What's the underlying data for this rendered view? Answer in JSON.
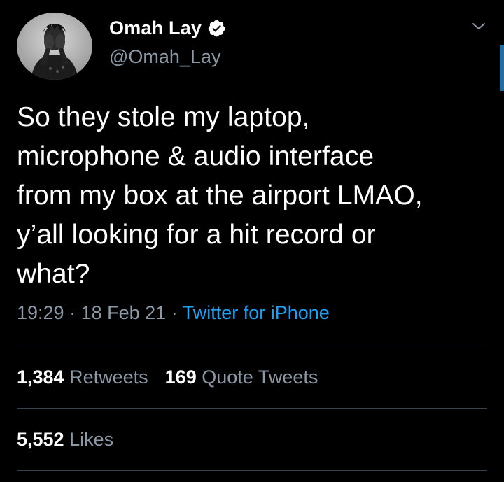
{
  "tweet": {
    "author": {
      "display_name": "Omah Lay",
      "handle": "@Omah_Lay",
      "verified_icon": "verified-badge-icon"
    },
    "text": "So they stole my laptop,\nmicrophone & audio interface\nfrom my box at the airport LMAO,\ny’all looking for a hit record or\nwhat?",
    "time": "19:29",
    "separator": "·",
    "date": "18 Feb 21",
    "source": "Twitter for iPhone",
    "stats": {
      "retweets_count": "1,384",
      "retweets_label": "Retweets",
      "quotes_count": "169",
      "quotes_label": "Quote Tweets",
      "likes_count": "5,552",
      "likes_label": "Likes"
    }
  },
  "colors": {
    "background": "#000000",
    "text_primary": "#ffffff",
    "text_secondary": "#8b98a5",
    "link": "#1da1f2",
    "divider": "#38444d"
  }
}
